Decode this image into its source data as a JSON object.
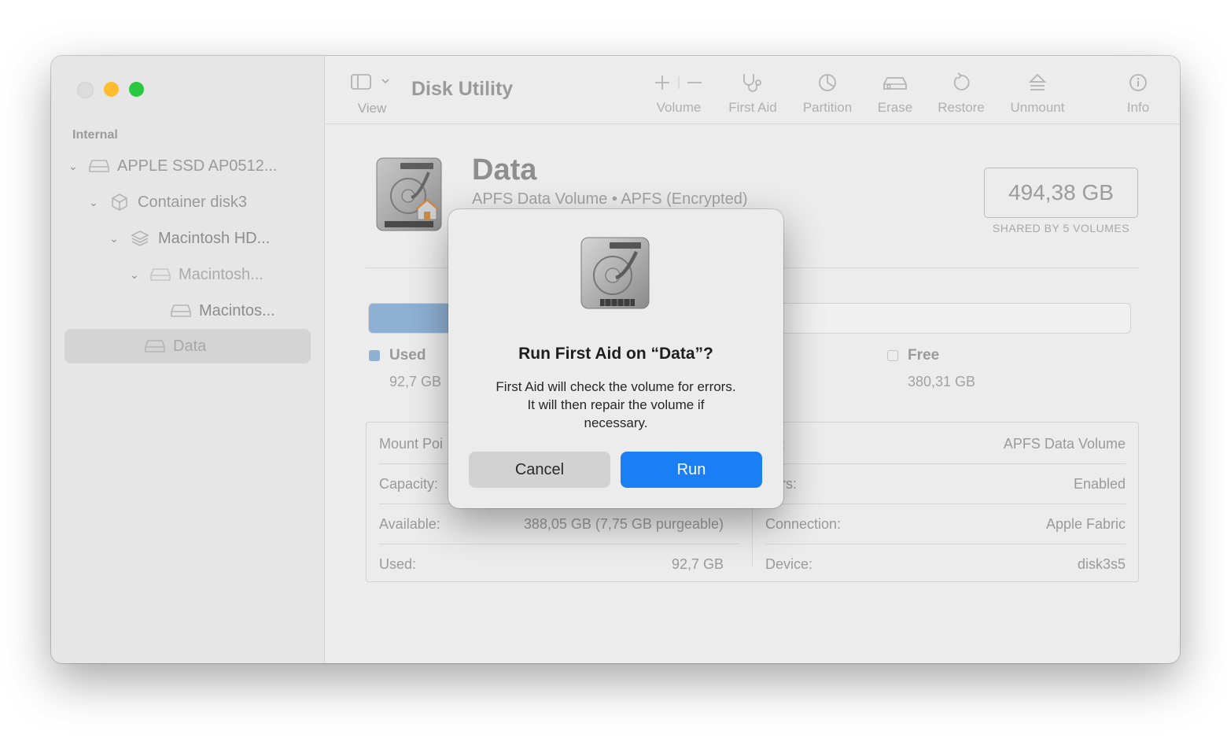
{
  "sidebar": {
    "section": "Internal",
    "items": [
      {
        "label": "APPLE SSD AP0512..."
      },
      {
        "label": "Container disk3"
      },
      {
        "label": "Macintosh HD..."
      },
      {
        "label": "Macintosh..."
      },
      {
        "label": "Macintos..."
      },
      {
        "label": "Data"
      }
    ]
  },
  "toolbar": {
    "view_label": "View",
    "title": "Disk Utility",
    "buttons": {
      "volume": "Volume",
      "first_aid": "First Aid",
      "partition": "Partition",
      "erase": "Erase",
      "restore": "Restore",
      "unmount": "Unmount",
      "info": "Info"
    }
  },
  "volume": {
    "name": "Data",
    "subtitle": "APFS Data Volume • APFS (Encrypted)",
    "size": "494,38 GB",
    "size_caption": "SHARED BY 5 VOLUMES",
    "used_fraction": 0.19
  },
  "legend": {
    "used_label": "Used",
    "used_value": "92,7 GB",
    "free_label": "Free",
    "free_value": "380,31 GB"
  },
  "info": {
    "left": [
      {
        "key": "Mount Poi",
        "value": ""
      },
      {
        "key": "Capacity:",
        "value": ""
      },
      {
        "key": "Available:",
        "value": "388,05 GB (7,75 GB purgeable)"
      },
      {
        "key": "Used:",
        "value": "92,7 GB"
      }
    ],
    "right": [
      {
        "key": "pe:",
        "value": "APFS Data Volume"
      },
      {
        "key": "ners:",
        "value": "Enabled"
      },
      {
        "key": "Connection:",
        "value": "Apple Fabric"
      },
      {
        "key": "Device:",
        "value": "disk3s5"
      }
    ]
  },
  "dialog": {
    "title": "Run First Aid on “Data”?",
    "message_line1": "First Aid will check the volume for errors.",
    "message_line2": "It will then repair the volume if",
    "message_line3": "necessary.",
    "cancel_label": "Cancel",
    "run_label": "Run"
  },
  "colors": {
    "accent": "#1a7ff5",
    "used": "#8eb0d2",
    "traffic_min": "#febc2e",
    "traffic_max": "#28c840"
  }
}
